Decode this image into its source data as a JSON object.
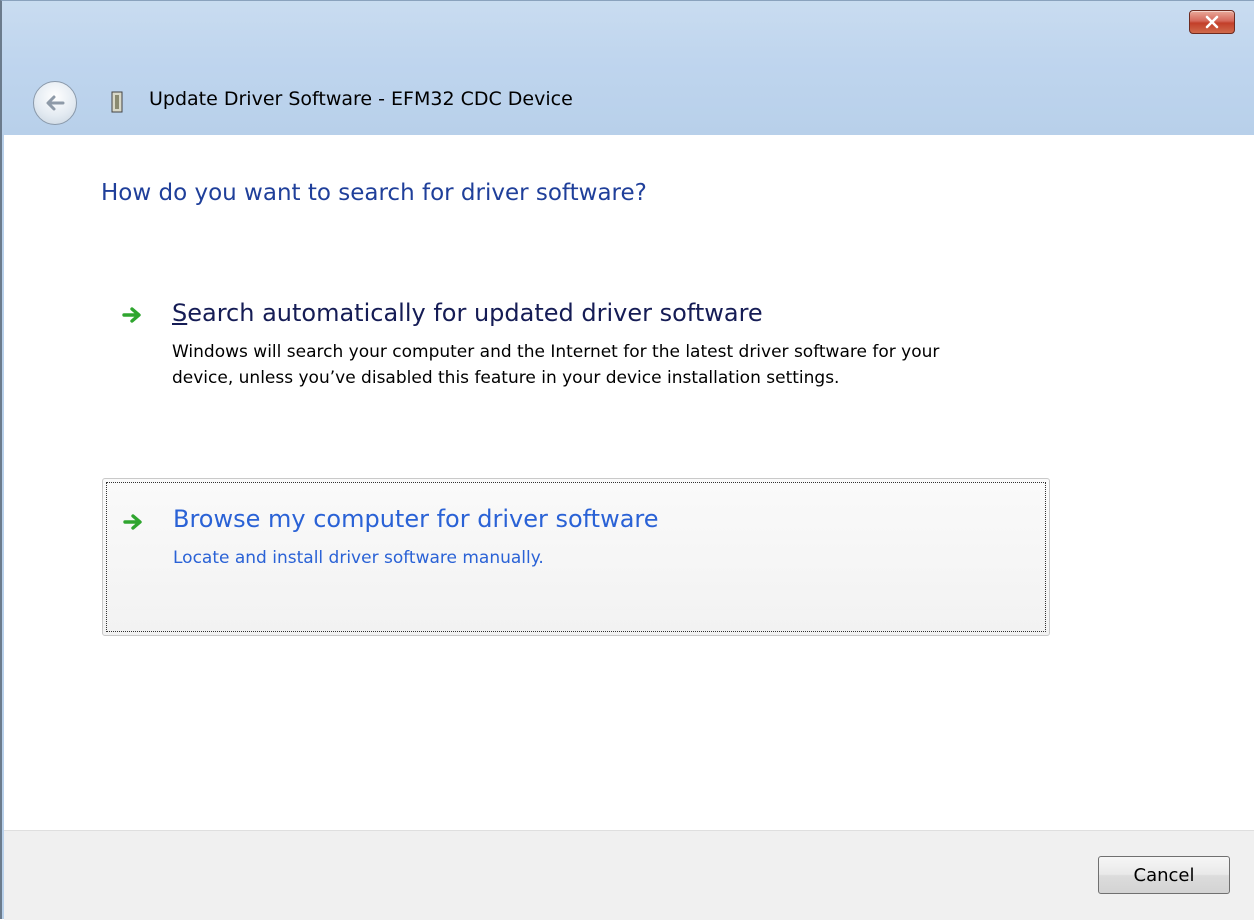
{
  "window": {
    "title": "Update Driver Software - EFM32 CDC Device",
    "close_icon": "close-icon",
    "back_icon": "back-arrow-icon",
    "device_icon": "usb-device-icon"
  },
  "main": {
    "heading": "How do you want to search for driver software?",
    "options": [
      {
        "title": "Search automatically for updated driver software",
        "description": "Windows will search your computer and the Internet for the latest driver software for your device, unless you’ve disabled this feature in your device installation settings.",
        "icon": "green-arrow-icon"
      },
      {
        "title": "Browse my computer for driver software",
        "description": "Locate and install driver software manually.",
        "icon": "green-arrow-icon"
      }
    ]
  },
  "footer": {
    "cancel_label": "Cancel"
  },
  "colors": {
    "heading": "#1f3f9a",
    "option_hover": "#2a62d6",
    "arrow_green": "#2fa52f"
  }
}
